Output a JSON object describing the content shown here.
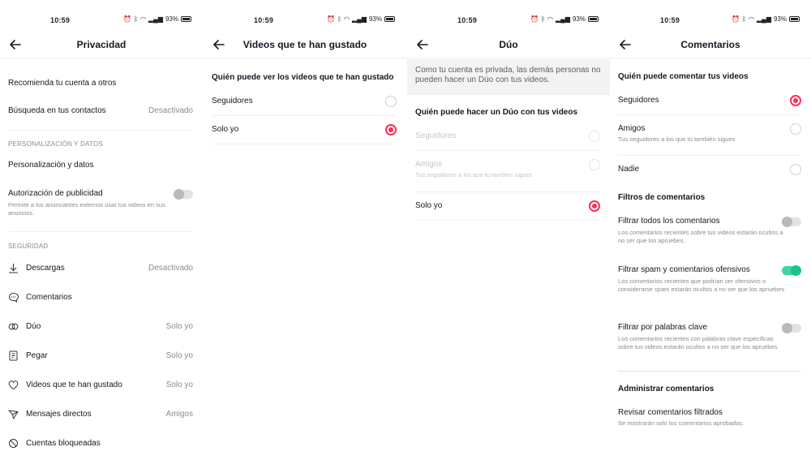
{
  "status": {
    "time": "10:59",
    "battery": "93%"
  },
  "p1": {
    "title": "Privacidad",
    "recommend": "Recomienda tu cuenta a otros",
    "contacts": {
      "label": "Búsqueda en tus contactos",
      "value": "Desactivado"
    },
    "sec_personal": "PERSONALIZACIÓN Y DATOS",
    "personal": "Personalización y datos",
    "ads": {
      "label": "Autorización de publicidad",
      "sub": "Permite a los anunciantes externos usar tus videos en sus anuncios."
    },
    "sec_security": "SEGURIDAD",
    "items": [
      {
        "label": "Descargas",
        "value": "Desactivado",
        "icon": "download-icon"
      },
      {
        "label": "Comentarios",
        "value": "",
        "icon": "comment-icon"
      },
      {
        "label": "Dúo",
        "value": "Solo yo",
        "icon": "duet-icon"
      },
      {
        "label": "Pegar",
        "value": "Solo yo",
        "icon": "stitch-icon"
      },
      {
        "label": "Videos que te han gustado",
        "value": "Solo yo",
        "icon": "heart-icon"
      },
      {
        "label": "Mensajes directos",
        "value": "Amigos",
        "icon": "send-icon"
      },
      {
        "label": "Cuentas bloqueadas",
        "value": "",
        "icon": "block-icon"
      }
    ]
  },
  "p2": {
    "title": "Videos que te han gustado",
    "heading": "Quién puede ver los videos que te han gustado",
    "options": [
      {
        "label": "Seguidores",
        "selected": false
      },
      {
        "label": "Solo yo",
        "selected": true
      }
    ]
  },
  "p3": {
    "title": "Dúo",
    "info": "Como tu cuenta es privada, las demás personas no pueden hacer un Dúo con tus videos.",
    "heading": "Quién puede hacer un Dúo con tus videos",
    "opt1": "Seguidores",
    "opt2": "Amigos",
    "opt2_sub": "Tus seguidores a los que tú también sigues",
    "opt3": "Solo yo"
  },
  "p4": {
    "title": "Comentarios",
    "heading": "Quién puede comentar tus videos",
    "opt1": "Seguidores",
    "opt2": "Amigos",
    "opt2_sub": "Tus seguidores a los que tú también sigues",
    "opt3": "Nadie",
    "filters_heading": "Filtros de comentarios",
    "f1": {
      "label": "Filtrar todos los comentarios",
      "sub": "Los comentarios recientes sobre tus videos estarán ocultos a no ser que los apruebes.",
      "on": false
    },
    "f2": {
      "label": "Filtrar spam y comentarios ofensivos",
      "sub": "Los comentarios recientes que podrían ser ofensivos o considerarse spam estarán ocultos a no ser que los apruebes",
      "on": true
    },
    "f3": {
      "label": "Filtrar por palabras clave",
      "sub": "Los comentarios recientes con palabras clave específicas sobre tus videos estarán ocultos a no ser que los apruebes.",
      "on": false
    },
    "manage_heading": "Administrar comentarios",
    "review": "Revisar comentarios filtrados",
    "review_sub": "Se mostrarán solo los comentarios aprobados."
  }
}
